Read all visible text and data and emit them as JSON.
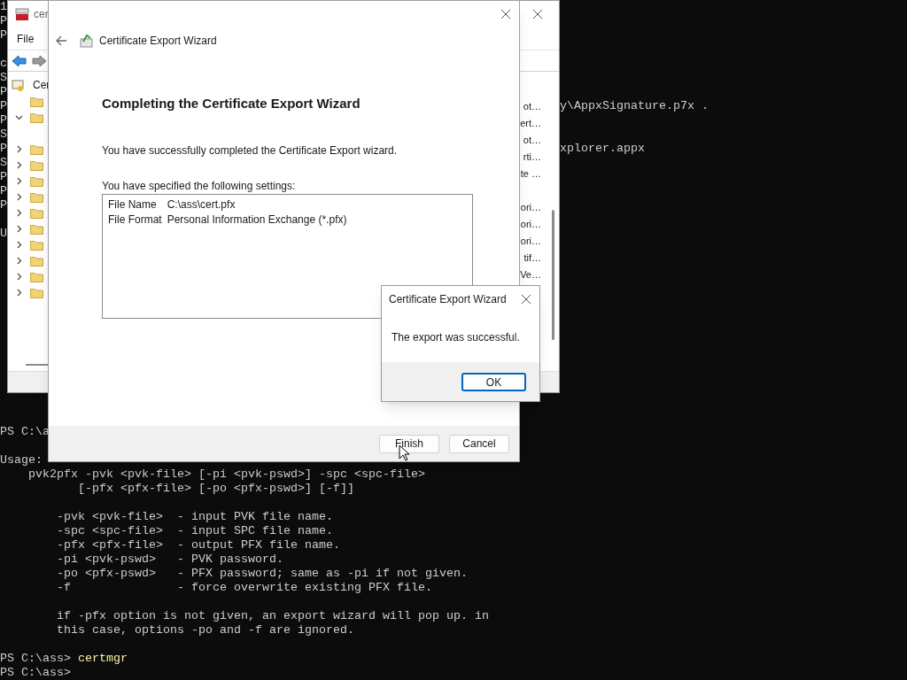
{
  "terminal": {
    "upper_lines": [
      {
        "edge": "1"
      },
      {
        "edge": "P"
      },
      {
        "edge": "P"
      },
      {
        "edge": "c",
        "blank_before": true
      },
      {
        "edge": "S"
      },
      {
        "edge": "P"
      },
      {
        "edge": "P",
        "right": "y\\AppxSignature.p7x ."
      },
      {
        "edge": "P"
      },
      {
        "edge": "S"
      },
      {
        "edge": "P",
        "right": "xplorer.appx"
      },
      {
        "edge": "S"
      },
      {
        "edge": "P"
      },
      {
        "edge": "P"
      },
      {
        "edge": "P"
      },
      {
        "edge": "U",
        "blank_before": true
      }
    ],
    "lower_lines": [
      {
        "kind": "text",
        "text": "PS C:\\a"
      },
      {
        "kind": "blank"
      },
      {
        "kind": "text",
        "text": "Usage:"
      },
      {
        "kind": "text",
        "text": "    pvk2pfx -pvk <pvk-file> [-pi <pvk-pswd>] -spc <spc-file>"
      },
      {
        "kind": "text",
        "text": "           [-pfx <pfx-file> [-po <pfx-pswd>] [-f]]"
      },
      {
        "kind": "blank"
      },
      {
        "kind": "text",
        "text": "        -pvk <pvk-file>  - input PVK file name."
      },
      {
        "kind": "text",
        "text": "        -spc <spc-file>  - input SPC file name."
      },
      {
        "kind": "text",
        "text": "        -pfx <pfx-file>  - output PFX file name."
      },
      {
        "kind": "text",
        "text": "        -pi <pvk-pswd>   - PVK password."
      },
      {
        "kind": "text",
        "text": "        -po <pfx-pswd>   - PFX password; same as -pi if not given."
      },
      {
        "kind": "text",
        "text": "        -f               - force overwrite existing PFX file."
      },
      {
        "kind": "blank"
      },
      {
        "kind": "text",
        "text": "        if -pfx option is not given, an export wizard will pop up. in"
      },
      {
        "kind": "text",
        "text": "        this case, options -po and -f are ignored."
      },
      {
        "kind": "blank"
      },
      {
        "kind": "prompt",
        "prompt": "PS C:\\ass>",
        "command": "certmgr"
      },
      {
        "kind": "prompt",
        "prompt": "PS C:\\ass>"
      }
    ]
  },
  "certmgr_window": {
    "title": "cer",
    "menu": [
      "File"
    ],
    "tree": {
      "root": "Cer",
      "folders": [
        {
          "has_children": false,
          "expanded": false
        },
        {
          "has_children": true,
          "expanded": true
        },
        {
          "has_children": true,
          "expanded": false
        },
        {
          "has_children": true,
          "expanded": false
        },
        {
          "has_children": true,
          "expanded": false
        },
        {
          "has_children": true,
          "expanded": false
        },
        {
          "has_children": true,
          "expanded": false
        },
        {
          "has_children": true,
          "expanded": false
        },
        {
          "has_children": true,
          "expanded": false
        },
        {
          "has_children": true,
          "expanded": false
        },
        {
          "has_children": true,
          "expanded": false
        },
        {
          "has_children": true,
          "expanded": false
        }
      ]
    },
    "list": [
      {
        "text": "ot…"
      },
      {
        "text": "ert…"
      },
      {
        "text": "ot…"
      },
      {
        "text": "rti…"
      },
      {
        "text": "te …"
      },
      {
        "text": "ori…",
        "blank_before": true
      },
      {
        "text": "ori…"
      },
      {
        "text": "ori…"
      },
      {
        "text": "tif…"
      },
      {
        "text": "Ve…"
      }
    ]
  },
  "wizard": {
    "title": "Certificate Export Wizard",
    "heading": "Completing the Certificate Export Wizard",
    "intro": "You have successfully completed the Certificate Export wizard.",
    "settings_label": "You have specified the following settings:",
    "settings": [
      {
        "label": "File Name",
        "value": "C:\\ass\\cert.pfx"
      },
      {
        "label": "File Format",
        "value": "Personal Information Exchange (*.pfx)"
      }
    ],
    "buttons": [
      {
        "label": "Finish",
        "default": false
      },
      {
        "label": "Cancel",
        "default": false
      }
    ]
  },
  "message_box": {
    "title": "Certificate Export Wizard",
    "message": "The export was successful.",
    "buttons": [
      {
        "label": "OK",
        "default": true
      }
    ]
  }
}
